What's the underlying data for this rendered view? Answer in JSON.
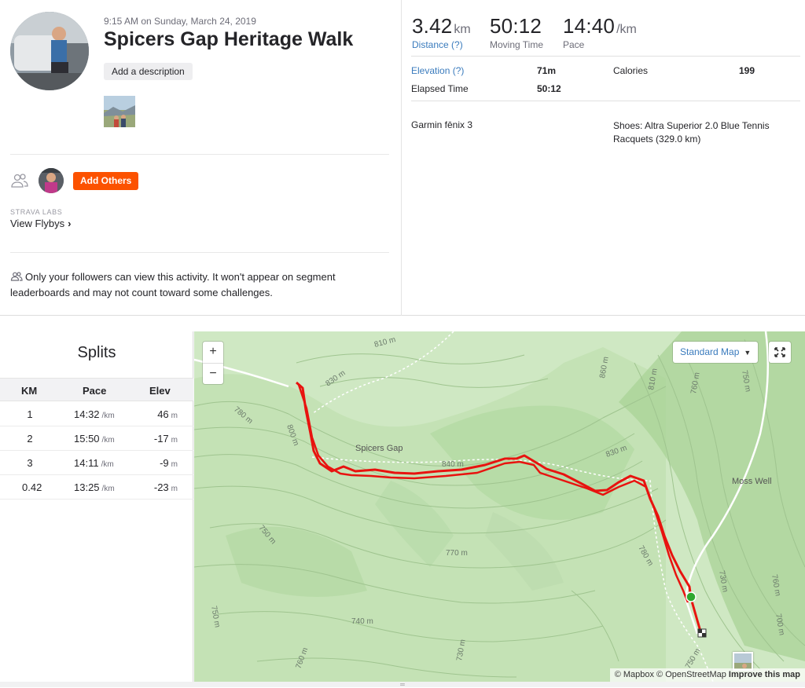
{
  "activity": {
    "datetime": "9:15 AM on Sunday, March 24, 2019",
    "title": "Spicers Gap Heritage Walk",
    "add_description": "Add a description",
    "add_others": "Add Others",
    "labs_label": "STRAVA LABS",
    "view_flybys": "View Flybys",
    "flybys_chevron": "›",
    "privacy_note": "Only your followers can view this activity. It won't appear on segment leaderboards and may not count toward some challenges."
  },
  "stats": {
    "distance": {
      "value": "3.42",
      "unit": "km",
      "label": "Distance (?)"
    },
    "moving_time": {
      "value": "50:12",
      "label": "Moving Time"
    },
    "pace": {
      "value": "14:40",
      "unit": "/km",
      "label": "Pace"
    },
    "elevation_label": "Elevation (?)",
    "elevation_value": "71m",
    "calories_label": "Calories",
    "calories_value": "199",
    "elapsed_label": "Elapsed Time",
    "elapsed_value": "50:12",
    "device": "Garmin fēnix 3",
    "shoes": "Shoes: Altra Superior 2.0 Blue Tennis Racquets (329.0 km)"
  },
  "splits": {
    "title": "Splits",
    "headers": [
      "KM",
      "Pace",
      "Elev"
    ],
    "pace_unit": "/km",
    "elev_unit": "m",
    "rows": [
      {
        "km": "1",
        "pace": "14:32",
        "elev": "46"
      },
      {
        "km": "2",
        "pace": "15:50",
        "elev": "-17"
      },
      {
        "km": "3",
        "pace": "14:11",
        "elev": "-9"
      },
      {
        "km": "0.42",
        "pace": "13:25",
        "elev": "-23"
      }
    ]
  },
  "map": {
    "zoom_in": "+",
    "zoom_out": "−",
    "style_select": "Standard Map",
    "style_caret": "▼",
    "attribution": "© Mapbox © OpenStreetMap",
    "improve": "Improve this map",
    "place_labels": [
      "Spicers Gap",
      "Moss Well"
    ],
    "contour_labels": [
      "810 m",
      "830 m",
      "780 m",
      "800 m",
      "840 m",
      "830 m",
      "860 m",
      "810 m",
      "760 m",
      "750 m",
      "770 m",
      "780 m",
      "750 m",
      "760 m",
      "740 m",
      "730 m",
      "750 m",
      "730 m",
      "760 m",
      "750 m",
      "700 m"
    ],
    "colors": {
      "route": "#e8130f",
      "start": "#2ea82e",
      "base": "#cfe8c3",
      "hill": "#b3d9a3",
      "contour": "#9fc48f"
    }
  }
}
